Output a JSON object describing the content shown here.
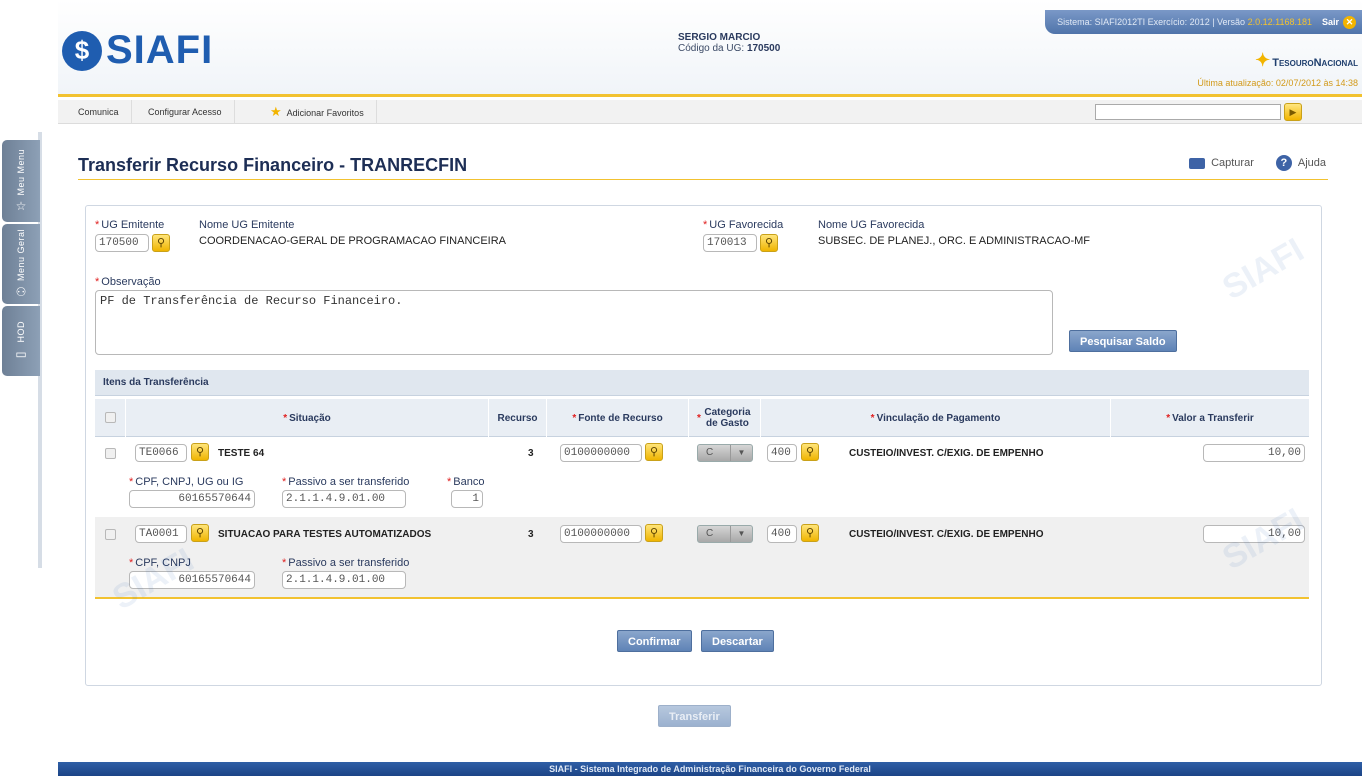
{
  "sidebar": {
    "tabs": [
      {
        "label": "Meu Menu",
        "icon": "star-icon"
      },
      {
        "label": "Menu Geral",
        "icon": "sitemap-icon"
      },
      {
        "label": "HOD",
        "icon": "monitor-icon"
      }
    ]
  },
  "header": {
    "logo": "SIAFI",
    "user_name": "SERGIO MARCIO",
    "ug_label": "Código da UG:",
    "ug_code": "170500",
    "system_text": "Sistema: SIAFI2012TI Exercício: 2012 | Versão ",
    "version": "2.0.12.1168.181",
    "logout_label": "Sair",
    "brand": "TesouroNacional",
    "last_update": "Última atualização: 02/07/2012 às 14:38"
  },
  "menu": {
    "items": [
      "Comunica",
      "Configurar Acesso",
      "Adicionar Favoritos"
    ],
    "search_placeholder": ""
  },
  "page": {
    "title": "Transferir Recurso Financeiro - TRANRECFIN",
    "capture_label": "Capturar",
    "help_label": "Ajuda"
  },
  "form": {
    "ug_emitente_label": "UG Emitente",
    "ug_emitente": "170500",
    "nome_ug_emitente_label": "Nome UG Emitente",
    "nome_ug_emitente": "COORDENACAO-GERAL DE PROGRAMACAO FINANCEIRA",
    "ug_favorecida_label": "UG Favorecida",
    "ug_favorecida": "170013",
    "nome_ug_favorecida_label": "Nome UG Favorecida",
    "nome_ug_favorecida": "SUBSEC. DE PLANEJ., ORC. E ADMINISTRACAO-MF",
    "observacao_label": "Observação",
    "observacao": "PF de Transferência de Recurso Financeiro.",
    "pesquisar_saldo": "Pesquisar Saldo"
  },
  "items": {
    "title": "Itens da Transferência",
    "columns": [
      "Situação",
      "Recurso",
      "Fonte de Recurso",
      "Categoria de Gasto",
      "Vinculação de Pagamento",
      "Valor a Transferir"
    ],
    "rows": [
      {
        "situacao": "TE0066",
        "situacao_desc": "TESTE 64",
        "recurso": "3",
        "fonte": "0100000000",
        "categoria": "C",
        "vinculacao": "400",
        "vinculacao_desc": "CUSTEIO/INVEST. C/EXIG. DE EMPENHO",
        "valor": "10,00",
        "sub_labels": [
          "CPF, CNPJ, UG ou IG",
          "Passivo a ser transferido",
          "Banco"
        ],
        "sub_values": [
          "60165570644",
          "2.1.1.4.9.01.00",
          "1"
        ]
      },
      {
        "situacao": "TA0001",
        "situacao_desc": "SITUACAO PARA TESTES AUTOMATIZADOS",
        "recurso": "3",
        "fonte": "0100000000",
        "categoria": "C",
        "vinculacao": "400",
        "vinculacao_desc": "CUSTEIO/INVEST. C/EXIG. DE EMPENHO",
        "valor": "10,00",
        "sub_labels": [
          "CPF, CNPJ",
          "Passivo a ser transferido"
        ],
        "sub_values": [
          "60165570644",
          "2.1.1.4.9.01.00"
        ]
      }
    ]
  },
  "buttons": {
    "confirmar": "Confirmar",
    "descartar": "Descartar",
    "transferir": "Transferir"
  },
  "footer": "SIAFI - Sistema Integrado de Administração Financeira do Governo Federal"
}
